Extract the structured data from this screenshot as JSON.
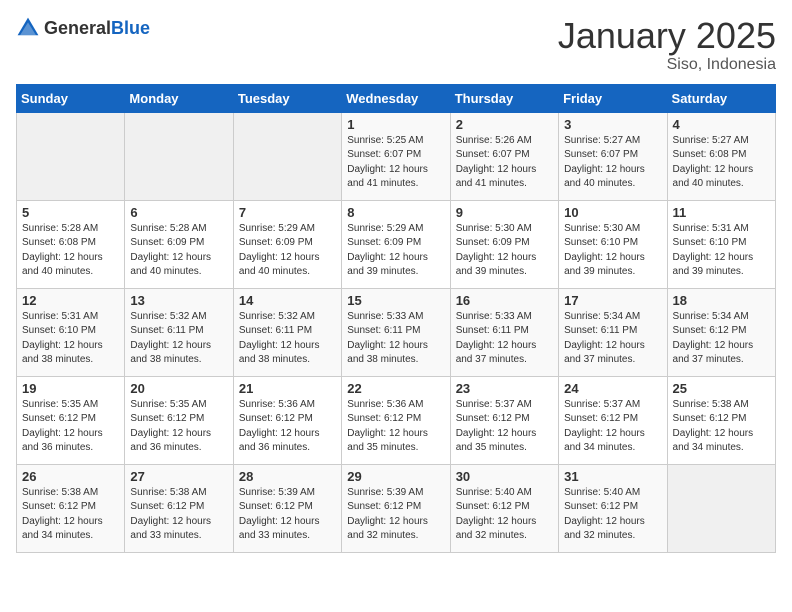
{
  "logo": {
    "general": "General",
    "blue": "Blue"
  },
  "header": {
    "title": "January 2025",
    "subtitle": "Siso, Indonesia"
  },
  "weekdays": [
    "Sunday",
    "Monday",
    "Tuesday",
    "Wednesday",
    "Thursday",
    "Friday",
    "Saturday"
  ],
  "weeks": [
    [
      {
        "day": "",
        "info": ""
      },
      {
        "day": "",
        "info": ""
      },
      {
        "day": "",
        "info": ""
      },
      {
        "day": "1",
        "info": "Sunrise: 5:25 AM\nSunset: 6:07 PM\nDaylight: 12 hours\nand 41 minutes."
      },
      {
        "day": "2",
        "info": "Sunrise: 5:26 AM\nSunset: 6:07 PM\nDaylight: 12 hours\nand 41 minutes."
      },
      {
        "day": "3",
        "info": "Sunrise: 5:27 AM\nSunset: 6:07 PM\nDaylight: 12 hours\nand 40 minutes."
      },
      {
        "day": "4",
        "info": "Sunrise: 5:27 AM\nSunset: 6:08 PM\nDaylight: 12 hours\nand 40 minutes."
      }
    ],
    [
      {
        "day": "5",
        "info": "Sunrise: 5:28 AM\nSunset: 6:08 PM\nDaylight: 12 hours\nand 40 minutes."
      },
      {
        "day": "6",
        "info": "Sunrise: 5:28 AM\nSunset: 6:09 PM\nDaylight: 12 hours\nand 40 minutes."
      },
      {
        "day": "7",
        "info": "Sunrise: 5:29 AM\nSunset: 6:09 PM\nDaylight: 12 hours\nand 40 minutes."
      },
      {
        "day": "8",
        "info": "Sunrise: 5:29 AM\nSunset: 6:09 PM\nDaylight: 12 hours\nand 39 minutes."
      },
      {
        "day": "9",
        "info": "Sunrise: 5:30 AM\nSunset: 6:09 PM\nDaylight: 12 hours\nand 39 minutes."
      },
      {
        "day": "10",
        "info": "Sunrise: 5:30 AM\nSunset: 6:10 PM\nDaylight: 12 hours\nand 39 minutes."
      },
      {
        "day": "11",
        "info": "Sunrise: 5:31 AM\nSunset: 6:10 PM\nDaylight: 12 hours\nand 39 minutes."
      }
    ],
    [
      {
        "day": "12",
        "info": "Sunrise: 5:31 AM\nSunset: 6:10 PM\nDaylight: 12 hours\nand 38 minutes."
      },
      {
        "day": "13",
        "info": "Sunrise: 5:32 AM\nSunset: 6:11 PM\nDaylight: 12 hours\nand 38 minutes."
      },
      {
        "day": "14",
        "info": "Sunrise: 5:32 AM\nSunset: 6:11 PM\nDaylight: 12 hours\nand 38 minutes."
      },
      {
        "day": "15",
        "info": "Sunrise: 5:33 AM\nSunset: 6:11 PM\nDaylight: 12 hours\nand 38 minutes."
      },
      {
        "day": "16",
        "info": "Sunrise: 5:33 AM\nSunset: 6:11 PM\nDaylight: 12 hours\nand 37 minutes."
      },
      {
        "day": "17",
        "info": "Sunrise: 5:34 AM\nSunset: 6:11 PM\nDaylight: 12 hours\nand 37 minutes."
      },
      {
        "day": "18",
        "info": "Sunrise: 5:34 AM\nSunset: 6:12 PM\nDaylight: 12 hours\nand 37 minutes."
      }
    ],
    [
      {
        "day": "19",
        "info": "Sunrise: 5:35 AM\nSunset: 6:12 PM\nDaylight: 12 hours\nand 36 minutes."
      },
      {
        "day": "20",
        "info": "Sunrise: 5:35 AM\nSunset: 6:12 PM\nDaylight: 12 hours\nand 36 minutes."
      },
      {
        "day": "21",
        "info": "Sunrise: 5:36 AM\nSunset: 6:12 PM\nDaylight: 12 hours\nand 36 minutes."
      },
      {
        "day": "22",
        "info": "Sunrise: 5:36 AM\nSunset: 6:12 PM\nDaylight: 12 hours\nand 35 minutes."
      },
      {
        "day": "23",
        "info": "Sunrise: 5:37 AM\nSunset: 6:12 PM\nDaylight: 12 hours\nand 35 minutes."
      },
      {
        "day": "24",
        "info": "Sunrise: 5:37 AM\nSunset: 6:12 PM\nDaylight: 12 hours\nand 34 minutes."
      },
      {
        "day": "25",
        "info": "Sunrise: 5:38 AM\nSunset: 6:12 PM\nDaylight: 12 hours\nand 34 minutes."
      }
    ],
    [
      {
        "day": "26",
        "info": "Sunrise: 5:38 AM\nSunset: 6:12 PM\nDaylight: 12 hours\nand 34 minutes."
      },
      {
        "day": "27",
        "info": "Sunrise: 5:38 AM\nSunset: 6:12 PM\nDaylight: 12 hours\nand 33 minutes."
      },
      {
        "day": "28",
        "info": "Sunrise: 5:39 AM\nSunset: 6:12 PM\nDaylight: 12 hours\nand 33 minutes."
      },
      {
        "day": "29",
        "info": "Sunrise: 5:39 AM\nSunset: 6:12 PM\nDaylight: 12 hours\nand 32 minutes."
      },
      {
        "day": "30",
        "info": "Sunrise: 5:40 AM\nSunset: 6:12 PM\nDaylight: 12 hours\nand 32 minutes."
      },
      {
        "day": "31",
        "info": "Sunrise: 5:40 AM\nSunset: 6:12 PM\nDaylight: 12 hours\nand 32 minutes."
      },
      {
        "day": "",
        "info": ""
      }
    ]
  ]
}
